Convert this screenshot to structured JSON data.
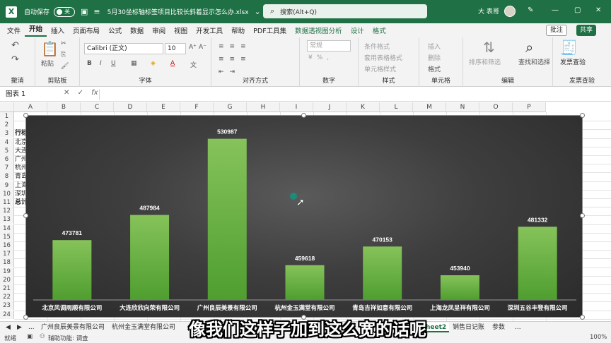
{
  "titlebar": {
    "autosave_label": "自动保存",
    "autosave_state": "关",
    "filename": "5月30坐标轴标签项目比较长斜着显示怎么办.xlsx",
    "search_placeholder": "搜索(Alt+Q)",
    "user_name": "大 表哥",
    "min": "—",
    "max": "▢",
    "close": "✕"
  },
  "menu": {
    "items": [
      "文件",
      "开始",
      "插入",
      "页面布局",
      "公式",
      "数据",
      "审阅",
      "视图",
      "开发工具",
      "帮助",
      "PDF工具集",
      "数据透视图分析",
      "设计",
      "格式"
    ],
    "active": "开始",
    "comment": "批注",
    "share": "共享"
  },
  "ribbon": {
    "undo_label": "撤消",
    "clipboard_label": "剪贴板",
    "paste_label": "粘贴",
    "font_label": "字体",
    "font_name": "Calibri (正文)",
    "font_size": "10",
    "align_label": "对齐方式",
    "number_label": "数字",
    "number_format": "常规",
    "styles_label": "样式",
    "cond_format": "条件格式",
    "table_format": "套用表格格式",
    "cell_style": "单元格样式",
    "cells_label": "单元格",
    "insert": "插入",
    "delete": "删除",
    "format": "格式",
    "edit_label": "编辑",
    "sort_filter": "排序和筛选",
    "find_select": "查找和选择",
    "invoice_check": "发票查验",
    "invoice_label": "发票查验"
  },
  "formula_bar": {
    "name_box": "图表 1",
    "fx": "fx"
  },
  "columns": [
    "A",
    "B",
    "C",
    "D",
    "E",
    "F",
    "G",
    "H",
    "I",
    "J",
    "K",
    "L",
    "M",
    "N",
    "O",
    "P"
  ],
  "rows": [
    "1",
    "2",
    "3",
    "4",
    "5",
    "6",
    "7",
    "8",
    "9",
    "10",
    "11",
    "12",
    "13",
    "14",
    "15",
    "16",
    "17",
    "18",
    "19",
    "20",
    "21",
    "22",
    "23",
    "24"
  ],
  "visible_cells": [
    {
      "row": "3",
      "text": "行标"
    },
    {
      "row": "4",
      "text": "北京"
    },
    {
      "row": "5",
      "text": "大连"
    },
    {
      "row": "6",
      "text": "广州"
    },
    {
      "row": "7",
      "text": "杭州"
    },
    {
      "row": "8",
      "text": "青岛"
    },
    {
      "row": "9",
      "text": "上海"
    },
    {
      "row": "10",
      "text": "深圳"
    },
    {
      "row": "11",
      "text": "总计"
    }
  ],
  "chart_data": {
    "type": "bar",
    "categories": [
      "北京风调雨顺有限公司",
      "大连欣欣向荣有限公司",
      "广州良辰美景有限公司",
      "杭州金玉满堂有限公司",
      "青岛吉祥如意有限公司",
      "上海龙凤呈祥有限公司",
      "深圳五谷丰登有限公司"
    ],
    "values": [
      473781,
      487984,
      530987,
      459618,
      470153,
      453940,
      481332
    ],
    "data_labels": [
      "473781",
      "487984",
      "530987",
      "459618",
      "470153",
      "453940",
      "481332"
    ],
    "ylim": [
      440000,
      540000
    ],
    "grid": false,
    "legend": "none",
    "bar_color": "#6fb544",
    "background": "#3a3a3a"
  },
  "sheet_tabs": {
    "nav_prev": "◀",
    "nav_next": "▶",
    "ellipsis": "...",
    "tabs": [
      "广州良辰美景有限公司",
      "杭州金玉满堂有限公司",
      "heet2",
      "销售日记账",
      "参数"
    ],
    "active": "heet2"
  },
  "status": {
    "ready": "就绪",
    "accessibility": "辅助功能: 调查",
    "zoom": "100%"
  },
  "caption": "像我们这样子加到这么宽的话呢"
}
